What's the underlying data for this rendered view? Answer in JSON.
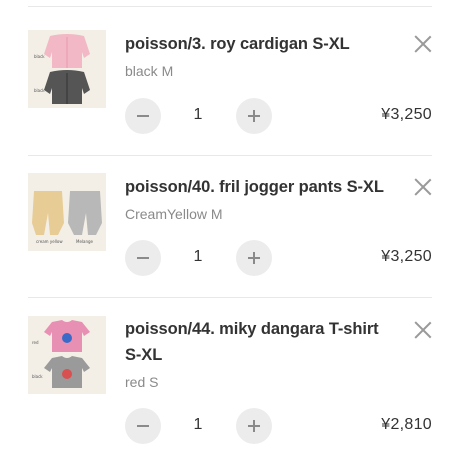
{
  "cart": {
    "items": [
      {
        "title": "poisson/3. roy cardigan S-XL",
        "variant": "black M",
        "quantity": "1",
        "price": "¥3,250",
        "thumb_labels": [
          "black",
          "black"
        ]
      },
      {
        "title": "poisson/40. fril jogger pants S-XL",
        "variant": "CreamYellow M",
        "quantity": "1",
        "price": "¥3,250",
        "thumb_labels": [
          "cream yellow",
          "Melange"
        ]
      },
      {
        "title": "poisson/44. miky dangara T-shirt S-XL",
        "variant": "red S",
        "quantity": "1",
        "price": "¥2,810",
        "thumb_labels": [
          "red",
          "black"
        ]
      }
    ]
  },
  "colors": {
    "divider": "#e8e8e8",
    "button_bg": "#ececec",
    "icon_gray": "#8a8a8a",
    "variant_text": "#8a8a8a",
    "thumb_bg": "#f3efe6"
  },
  "icons": {
    "remove": "close-icon",
    "decrease": "minus-icon",
    "increase": "plus-icon"
  }
}
